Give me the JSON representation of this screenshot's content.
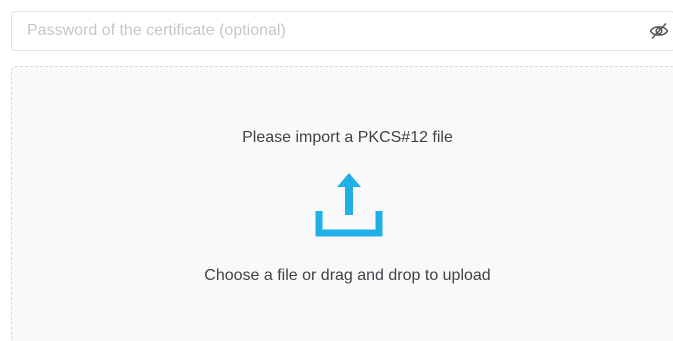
{
  "password": {
    "placeholder": "Password of the certificate (optional)",
    "value": "",
    "toggle_icon": "eye-slash-icon"
  },
  "dropzone": {
    "title": "Please import a PKCS#12 file",
    "subtitle": "Choose a file or drag and drop to upload",
    "icon": "upload-icon"
  },
  "colors": {
    "accent": "#1fb0e8",
    "text": "#3f4347",
    "placeholder": "#c4c7ca",
    "border": "#dfe3e6",
    "dropzone_bg": "#f9f9f9"
  }
}
